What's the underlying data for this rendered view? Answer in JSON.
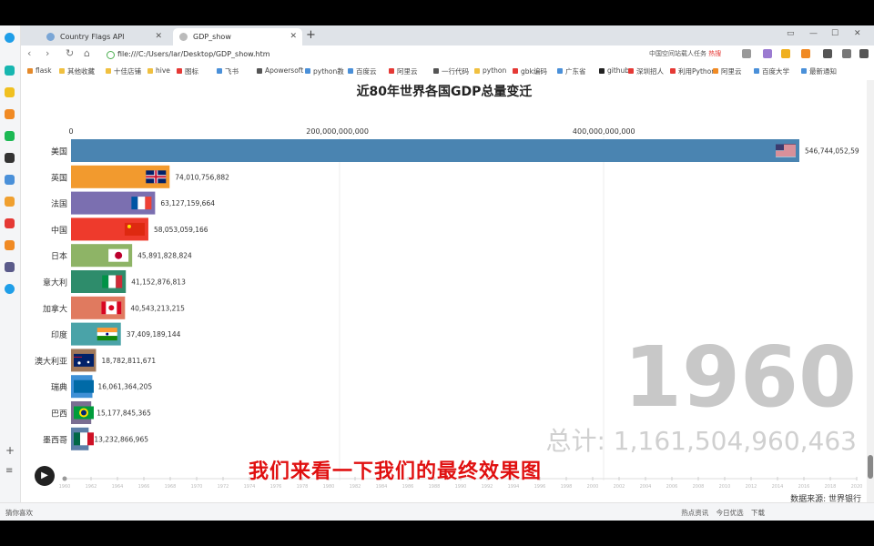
{
  "browser": {
    "tabs": [
      {
        "label": "Country Flags API",
        "active": false
      },
      {
        "label": "GDP_show",
        "active": true
      }
    ],
    "url": "file:///C:/Users/lar/Desktop/GDP_show.htm",
    "search_text": "中国空间站载人任务",
    "search_hot": "热搜",
    "bookmarks": [
      "flask",
      "其他收藏",
      "十佳店铺",
      "hive",
      "图标",
      "飞书",
      "Apowersoft",
      "python教",
      "百度云",
      "阿里云",
      "一行代码",
      "python",
      "gbk编码",
      "广东省",
      "github",
      "深圳招人",
      "利用Python",
      "阿里云",
      "百度大学",
      "最新通知"
    ]
  },
  "chart_data": {
    "type": "bar",
    "title": "近80年世界各国GDP总量变迁",
    "year": "1960",
    "total_label": "总计: 1,161,504,960,463",
    "xlim": [
      0,
      546744052593
    ],
    "x_ticks": [
      0,
      200000000000,
      400000000000
    ],
    "x_tick_labels": [
      "0",
      "200,000,000,000",
      "400,000,000,000"
    ],
    "categories": [
      "美国",
      "英国",
      "法国",
      "中国",
      "日本",
      "意大利",
      "加拿大",
      "印度",
      "澳大利亚",
      "瑞典",
      "巴西",
      "墨西哥"
    ],
    "values": [
      546744052593,
      74010756882,
      63127159664,
      58053059166,
      45891828824,
      41152876813,
      40543213215,
      37409189144,
      18782811671,
      16061364205,
      15177845365,
      13232866965
    ],
    "value_labels": [
      "546,744,052,59",
      "74,010,756,882",
      "63,127,159,664",
      "58,053,059,166",
      "45,891,828,824",
      "41,152,876,813",
      "40,543,213,215",
      "37,409,189,144",
      "18,782,811,671",
      "16,061,364,205",
      "15,177,845,365",
      "13,232,866,965"
    ],
    "colors": [
      "#4a84b1",
      "#f29a2e",
      "#7b6fb0",
      "#ee3a2c",
      "#8eb466",
      "#2e8c6b",
      "#e07a5f",
      "#4aa3a8",
      "#a0785a",
      "#3f90d6",
      "#7a6e92",
      "#5c7fa8"
    ],
    "flags": [
      "us",
      "gb",
      "fr",
      "cn",
      "jp",
      "it",
      "ca",
      "in",
      "au",
      "se",
      "br",
      "mx"
    ]
  },
  "subtitle": "我们来看一下我们的最终效果图",
  "source": "数据来源: 世界银行",
  "timeline_years": [
    "1960",
    "1962",
    "1964",
    "1966",
    "1968",
    "1970",
    "1972",
    "1974",
    "1976",
    "1978",
    "1980",
    "1982",
    "1984",
    "1986",
    "1988",
    "1990",
    "1992",
    "1994",
    "1996",
    "1998",
    "2000",
    "2002",
    "2004",
    "2006",
    "2008",
    "2010",
    "2012",
    "2014",
    "2016",
    "2018",
    "2020"
  ],
  "statusbar": {
    "left": "猜你喜欢",
    "right": "热点资讯 今日优选 下载"
  }
}
